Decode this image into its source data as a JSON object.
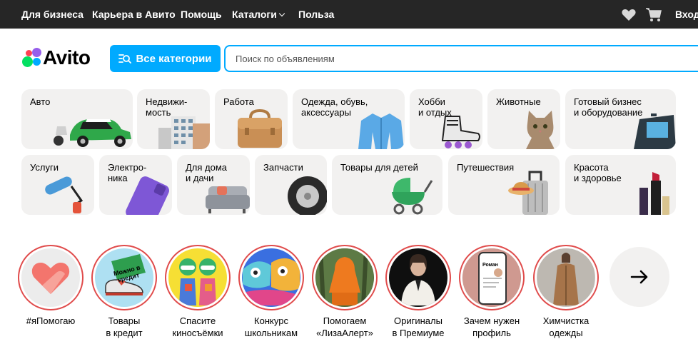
{
  "topbar": {
    "links": [
      "Для бизнеса",
      "Карьера в Авито",
      "Помощь",
      "Каталоги",
      "Польза"
    ],
    "login": "Вход",
    "icons": [
      "heart-icon",
      "cart-icon"
    ]
  },
  "header": {
    "logo_text": "Avito",
    "categories_button": "Все категории",
    "search_placeholder": "Поиск по объявлениям"
  },
  "categories": [
    "Авто",
    "Недвижи-\nмость",
    "Работа",
    "Одежда, обувь,\nаксессуары",
    "Хобби\nи отдых",
    "Животные",
    "Готовый бизнес\nи оборудование",
    "Услуги",
    "Электро-\nника",
    "Для дома\nи дачи",
    "Запчасти",
    "Товары для детей",
    "Путешествия",
    "Красота\nи здоровье"
  ],
  "stories": [
    {
      "caption": "#яПомогаю"
    },
    {
      "caption": "Товары\nв кредит",
      "badge": "Можно в кредит"
    },
    {
      "caption": "Спасите\nкиносъёмки"
    },
    {
      "caption": "Конкурс\nшкольникам"
    },
    {
      "caption": "Помогаем\n«ЛизаАлерт»"
    },
    {
      "caption": "Оригиналы\nв Премиуме"
    },
    {
      "caption": "Зачем нужен\nпрофиль",
      "badge": "Роман"
    },
    {
      "caption": "Химчистка\nодежды"
    }
  ],
  "colors": {
    "accent": "#00aaff",
    "topbar": "#262626",
    "tile": "#f2f1f0",
    "story_ring": "#e04b4b"
  }
}
